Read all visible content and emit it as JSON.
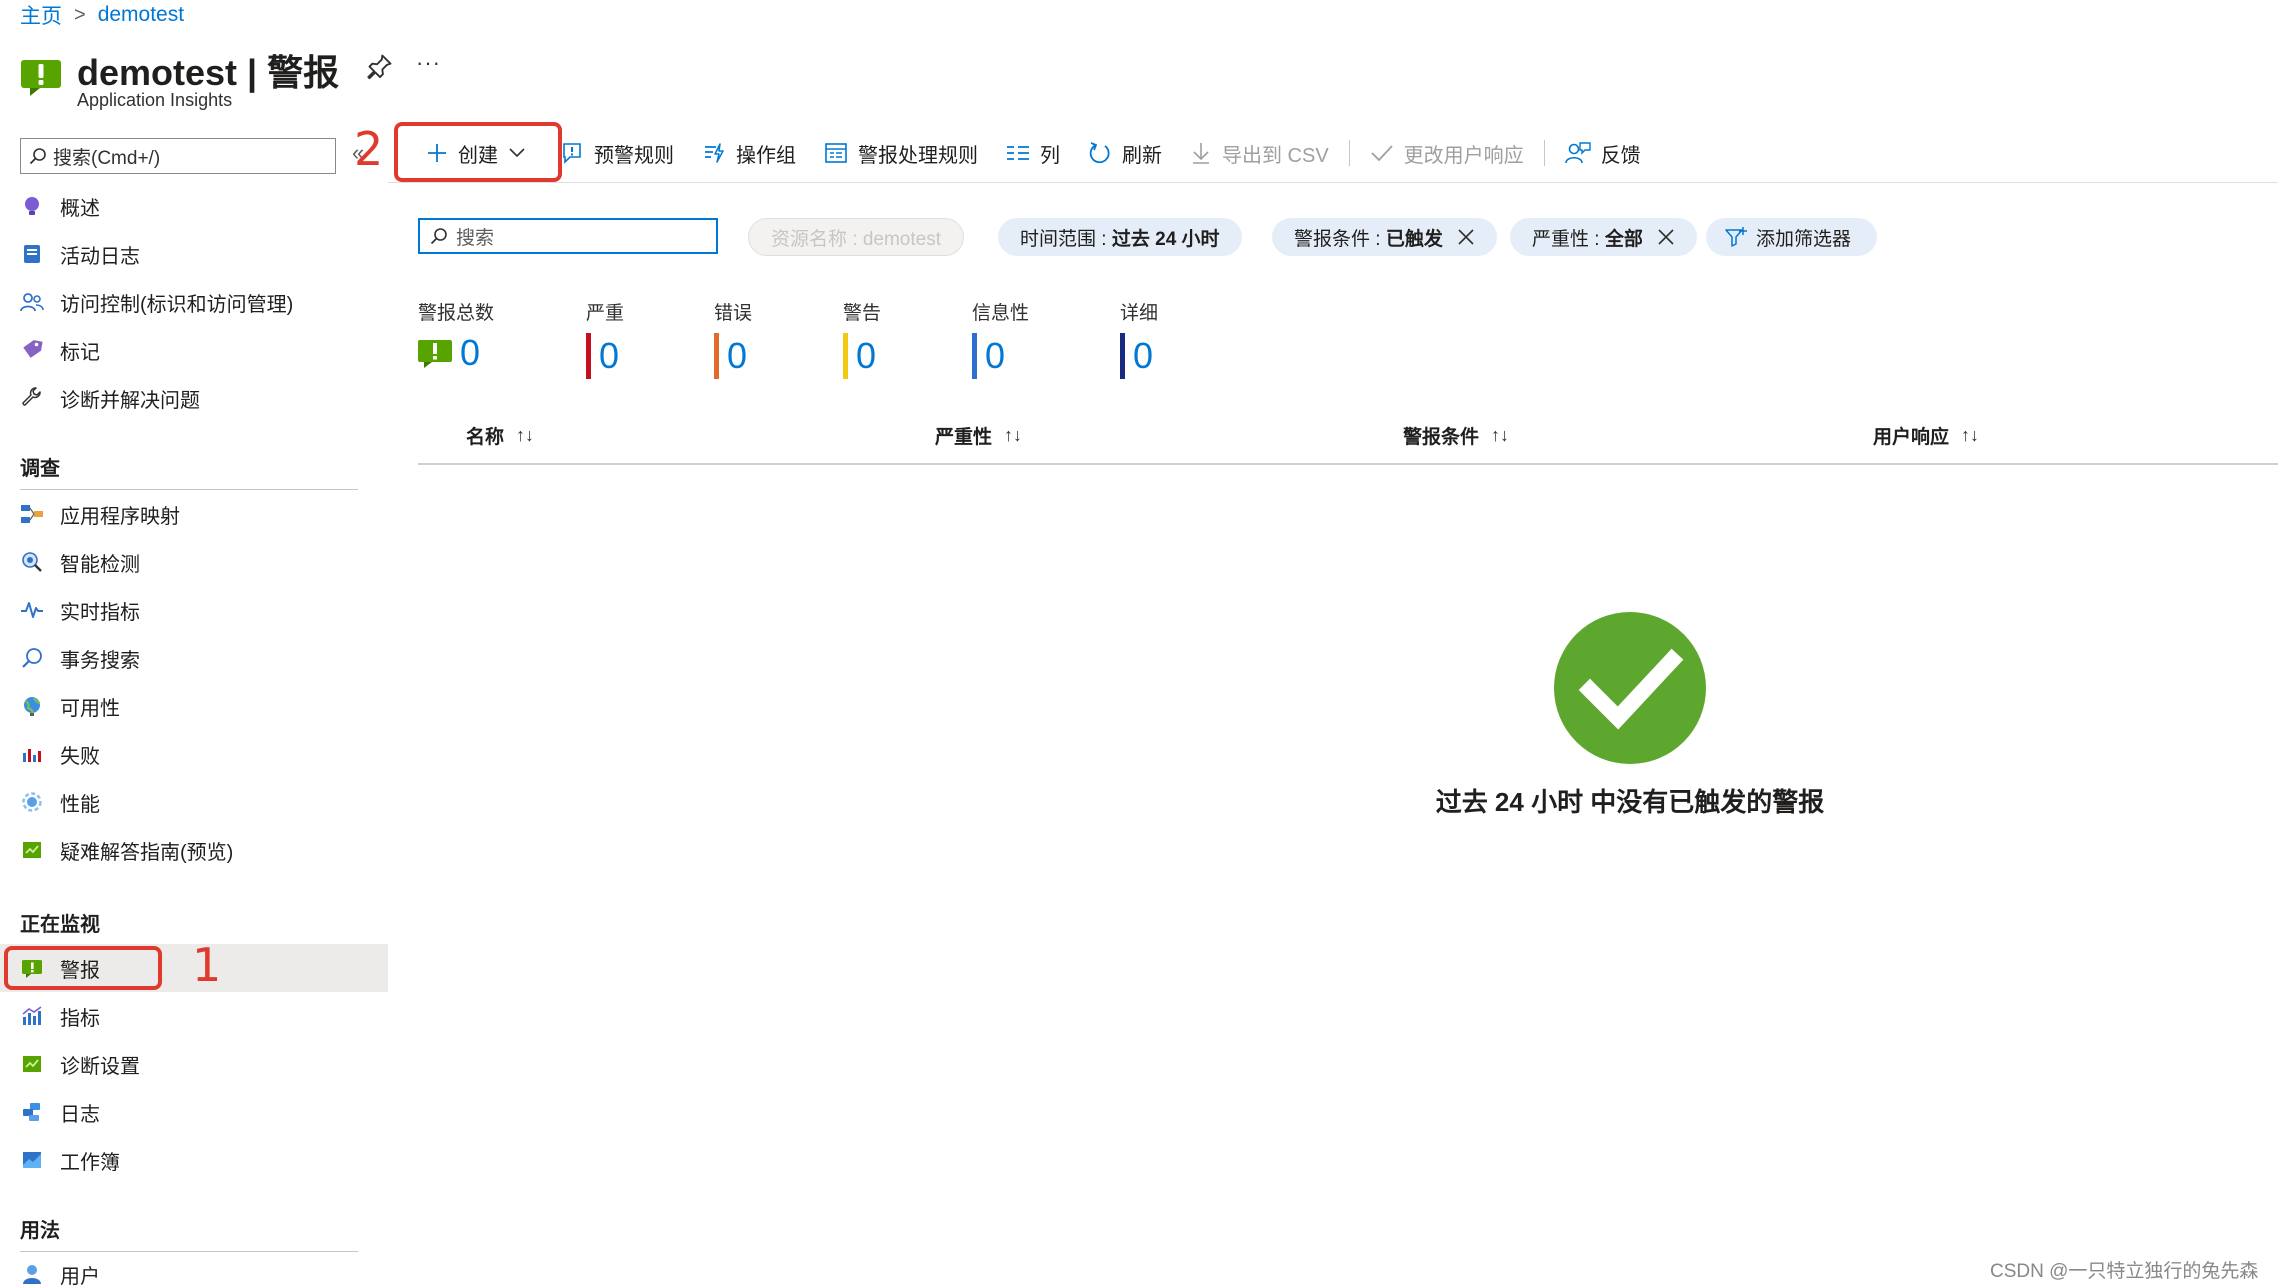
{
  "breadcrumb": {
    "home": "主页",
    "current": "demotest"
  },
  "header": {
    "title": "demotest | 警报",
    "subtitle": "Application Insights",
    "more_glyph": "···"
  },
  "sidebar": {
    "search_placeholder": "搜索(Cmd+/)",
    "collapse_glyph": "«",
    "top_items": [
      {
        "label": "概述",
        "icon": "bulb-icon"
      },
      {
        "label": "活动日志",
        "icon": "activity-log-icon"
      },
      {
        "label": "访问控制(标识和访问管理)",
        "icon": "people-icon"
      },
      {
        "label": "标记",
        "icon": "tag-icon"
      },
      {
        "label": "诊断并解决问题",
        "icon": "wrench-icon"
      }
    ],
    "sections": [
      {
        "title": "调查",
        "items": [
          {
            "label": "应用程序映射",
            "icon": "app-map-icon"
          },
          {
            "label": "智能检测",
            "icon": "smart-detection-icon"
          },
          {
            "label": "实时指标",
            "icon": "live-metrics-icon"
          },
          {
            "label": "事务搜索",
            "icon": "search-icon"
          },
          {
            "label": "可用性",
            "icon": "globe-icon"
          },
          {
            "label": "失败",
            "icon": "failures-icon"
          },
          {
            "label": "性能",
            "icon": "performance-icon"
          },
          {
            "label": "疑难解答指南(预览)",
            "icon": "guide-icon"
          }
        ]
      },
      {
        "title": "正在监视",
        "items": [
          {
            "label": "警报",
            "icon": "alert-icon",
            "active": true
          },
          {
            "label": "指标",
            "icon": "metrics-icon"
          },
          {
            "label": "诊断设置",
            "icon": "diagnostic-icon"
          },
          {
            "label": "日志",
            "icon": "logs-icon"
          },
          {
            "label": "工作簿",
            "icon": "workbook-icon"
          }
        ]
      },
      {
        "title": "用法",
        "items": [
          {
            "label": "用户",
            "icon": "user-icon"
          }
        ]
      }
    ]
  },
  "toolbar": {
    "create": "创建",
    "alert_rules": "预警规则",
    "action_groups": "操作组",
    "processing_rules": "警报处理规则",
    "columns": "列",
    "refresh": "刷新",
    "export_csv": "导出到 CSV",
    "change_response": "更改用户响应",
    "feedback": "反馈"
  },
  "annotations": {
    "one": "1",
    "two": "2",
    "color": "#e03a2f"
  },
  "filters": {
    "search_placeholder": "搜索",
    "resource_name": "资源名称 : demotest",
    "time_range_label": "时间范围 : ",
    "time_range_value": "过去 24 小时",
    "condition_label": "警报条件 : ",
    "condition_value": "已触发",
    "severity_label": "严重性 : ",
    "severity_value": "全部",
    "add_filter": "添加筛选器"
  },
  "summary": [
    {
      "label": "警报总数",
      "value": "0",
      "color": "#57a300"
    },
    {
      "label": "严重",
      "value": "0",
      "color": "#c50f1f"
    },
    {
      "label": "错误",
      "value": "0",
      "color": "#e06b2b"
    },
    {
      "label": "警告",
      "value": "0",
      "color": "#f2c811"
    },
    {
      "label": "信息性",
      "value": "0",
      "color": "#2c6fcd"
    },
    {
      "label": "详细",
      "value": "0",
      "color": "#1a2a80"
    }
  ],
  "table": {
    "columns": [
      "名称",
      "严重性",
      "警报条件",
      "用户响应"
    ],
    "sort_glyph": "↑↓"
  },
  "empty_state": {
    "message": "过去 24 小时 中没有已触发的警报",
    "color": "#5ea72f"
  },
  "watermark": "CSDN @一只特立独行的兔先森",
  "colors": {
    "accent": "#0078d4",
    "alert_green": "#57a300"
  }
}
